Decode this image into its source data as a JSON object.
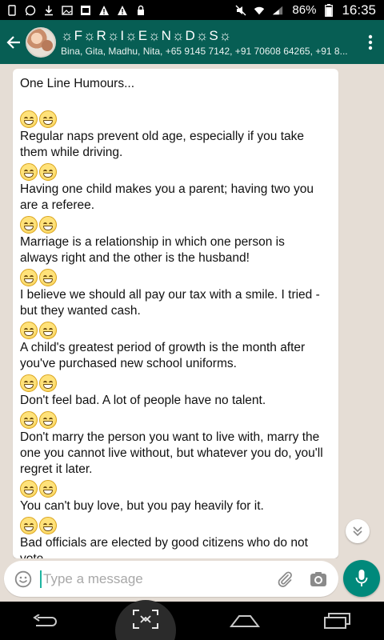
{
  "status_bar": {
    "battery": "86%",
    "time": "16:35"
  },
  "header": {
    "title": "☼F☼R☼I☼E☼N☼D☼S☼",
    "subtitle": "Bina, Gita, Madhu, Nita, +65 9145 7142, +91 70608 64265, +91 8..."
  },
  "message": {
    "intro": "One Line Humours...",
    "jokes": [
      [
        "Regular naps prevent old age, especially if you take",
        "them while driving."
      ],
      [
        "Having one child makes you a parent; having two you",
        "are a referee."
      ],
      [
        "Marriage is a relationship in which one person is",
        "always right and the other is the husband!"
      ],
      [
        "I believe we should all pay our tax with a smile. I tried -",
        "but they wanted cash."
      ],
      [
        "A child's greatest period of growth is the month after",
        "you've purchased new school uniforms."
      ],
      [
        "Don't feel bad. A lot of people have no talent."
      ],
      [
        "Don't marry the person you want to live with, marry the",
        "one you cannot live without, but whatever you do, you'll",
        "regret it later."
      ],
      [
        "You can't buy love, but you pay heavily for it."
      ],
      [
        "Bad officials are elected by good citizens who do not",
        "vote."
      ]
    ]
  },
  "composer": {
    "placeholder": "Type a message"
  },
  "icons": {
    "back": "arrow-left-icon",
    "overflow": "more-vert-icon",
    "emoji": "emoji-icon",
    "attach": "paperclip-icon",
    "camera": "camera-icon",
    "mic": "microphone-icon",
    "scroll": "double-chevron-down-icon"
  },
  "colors": {
    "header": "#075e54",
    "accent": "#00897b",
    "chat_background": "#e5ddd5"
  }
}
